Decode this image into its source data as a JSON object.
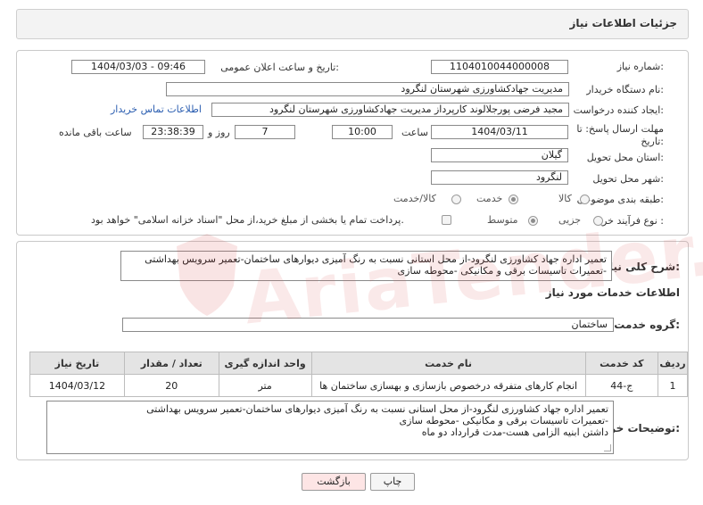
{
  "header": {
    "title": "جزئیات اطلاعات نیاز"
  },
  "form": {
    "need_number": {
      "label": "شماره نیاز:",
      "value": "1104010044000008"
    },
    "announce": {
      "label": "تاریخ و ساعت اعلان عمومی:",
      "value": "1404/03/03 - 09:46"
    },
    "buyer_org": {
      "label": "نام دستگاه خریدار:",
      "value": "مدیریت جهادکشاورزی شهرستان لنگرود"
    },
    "requester": {
      "label": "ایجاد کننده درخواست:",
      "value": "مجید فرضی پورجلالوند کارپرداز مدیریت جهادکشاورزی شهرستان لنگرود",
      "contact_link": "اطلاعات تماس خریدار"
    },
    "deadline": {
      "label": "مهلت ارسال پاسخ: تا تاریخ:",
      "date": "1404/03/11",
      "time_label": "ساعت",
      "time": "10:00",
      "days": "7",
      "days_label": "روز و",
      "remaining": "23:38:39",
      "remaining_label": "ساعت باقی مانده"
    },
    "province": {
      "label": "استان محل تحویل:",
      "value": "گیلان"
    },
    "city": {
      "label": "شهر محل تحویل:",
      "value": "لنگرود"
    },
    "category": {
      "label": "طبقه بندی موضوعی:",
      "options": [
        "کالا",
        "خدمت",
        "کالا/خدمت"
      ],
      "selected": "خدمت"
    },
    "process": {
      "label": "نوع فرآیند خرید :",
      "options": [
        "جزیی",
        "متوسط"
      ],
      "selected": "متوسط",
      "payment_note": "پرداخت تمام یا بخشی از مبلغ خرید،از محل \"اسناد خزانه اسلامی\" خواهد بود."
    }
  },
  "summary": {
    "label": "شرح کلی نیاز:",
    "text": "تعمیر اداره جهاد کشاورزی لنگرود-از محل استانی نسبت به رنگ آمیزی دیوارهای ساختمان-تعمیر سرویس بهداشتی -تعمیرات تاسیسات برقی و مکانیکی -محوطه سازی"
  },
  "services": {
    "section_title": "اطلاعات خدمات مورد نیاز",
    "group_label": "گروه خدمت:",
    "group_value": "ساختمان",
    "columns": [
      "ردیف",
      "کد خدمت",
      "نام خدمت",
      "واحد اندازه گیری",
      "تعداد / مقدار",
      "تاریخ نیاز"
    ],
    "rows": [
      [
        "1",
        "ج-44",
        "انجام کارهای متفرقه درخصوص بازسازی و بهسازی ساختمان ها",
        "متر",
        "20",
        "1404/03/12"
      ]
    ]
  },
  "buyer_notes": {
    "label": "توضیحات خریدار:",
    "lines": [
      "تعمیر اداره جهاد کشاورزی لنگرود-از محل استانی نسبت به رنگ آمیزی دیوارهای ساختمان-تعمیر سرویس بهداشتی",
      "-تعمیرات تاسیسات برقی و مکانیکی -محوطه سازی",
      "داشتن ابنیه الزامی هست-مدت قرارداد دو ماه"
    ]
  },
  "buttons": {
    "print": "چاپ",
    "back": "بازگشت"
  },
  "watermark": "AriaTender.neT"
}
